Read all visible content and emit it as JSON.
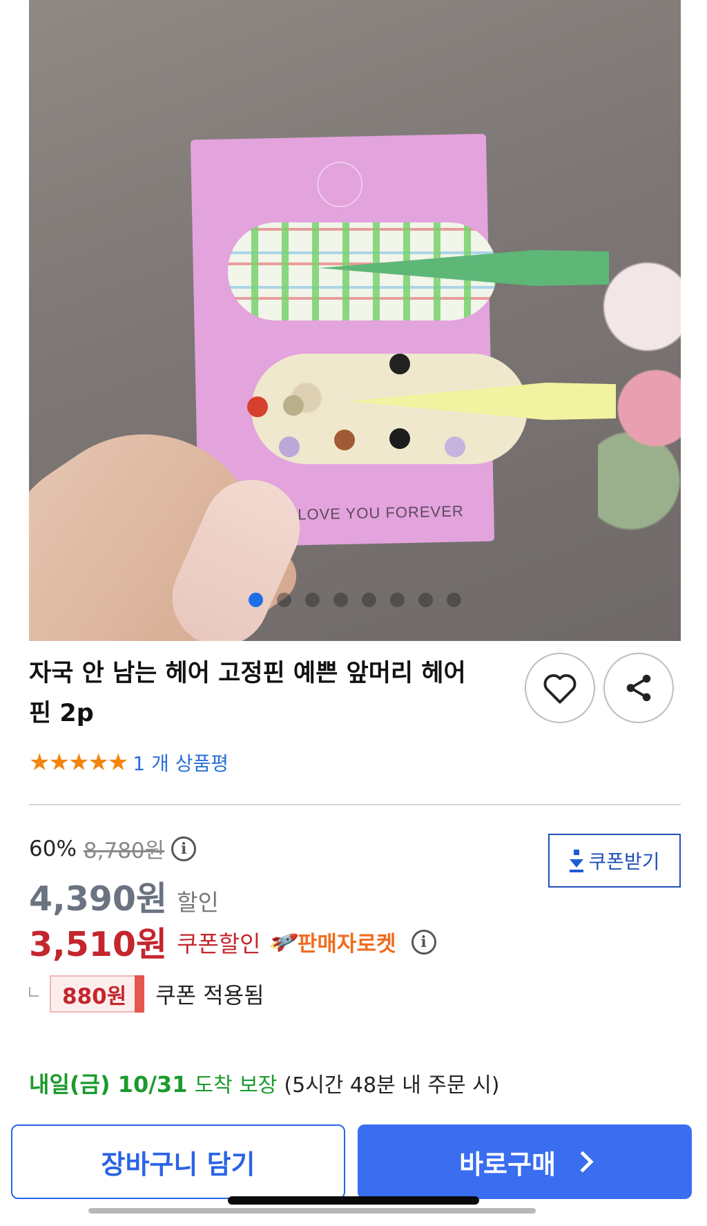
{
  "product": {
    "image_alt": "hair-clip product photo",
    "card_text": "I LOVE YOU FOREVER",
    "carousel": {
      "total": 8,
      "active_index": 0
    },
    "title": "자국 안 남는 헤어 고정핀 예쁜 앞머리 헤어핀 2p",
    "rating": {
      "stars": 5,
      "review_text": "1 개 상품평"
    }
  },
  "price": {
    "discount_percent": "60%",
    "original_price": "8,780원",
    "sale_price": "4,390원",
    "sale_label": "할인",
    "coupon_price": "3,510원",
    "coupon_label": "쿠폰할인",
    "seller_rocket": "판매자로켓",
    "coupon_amount": "880원",
    "coupon_applied": "쿠폰 적용됨",
    "coupon_button": "쿠폰받기"
  },
  "delivery": {
    "date": "내일(금) 10/31",
    "guarantee": "도착 보장",
    "note": "(5시간 48분 내 주문 시)"
  },
  "actions": {
    "cart": "장바구니 담기",
    "buy": "바로구매"
  },
  "colors": {
    "primary_blue": "#3a6df0",
    "coupon_red": "#c4262e",
    "delivery_green": "#1a9b2c",
    "rocket_orange": "#ef6c1f",
    "star_orange": "#f2850e"
  },
  "icons": [
    "heart-icon",
    "share-icon",
    "info-icon",
    "rocket-icon",
    "download-icon",
    "chevron-right-icon"
  ]
}
